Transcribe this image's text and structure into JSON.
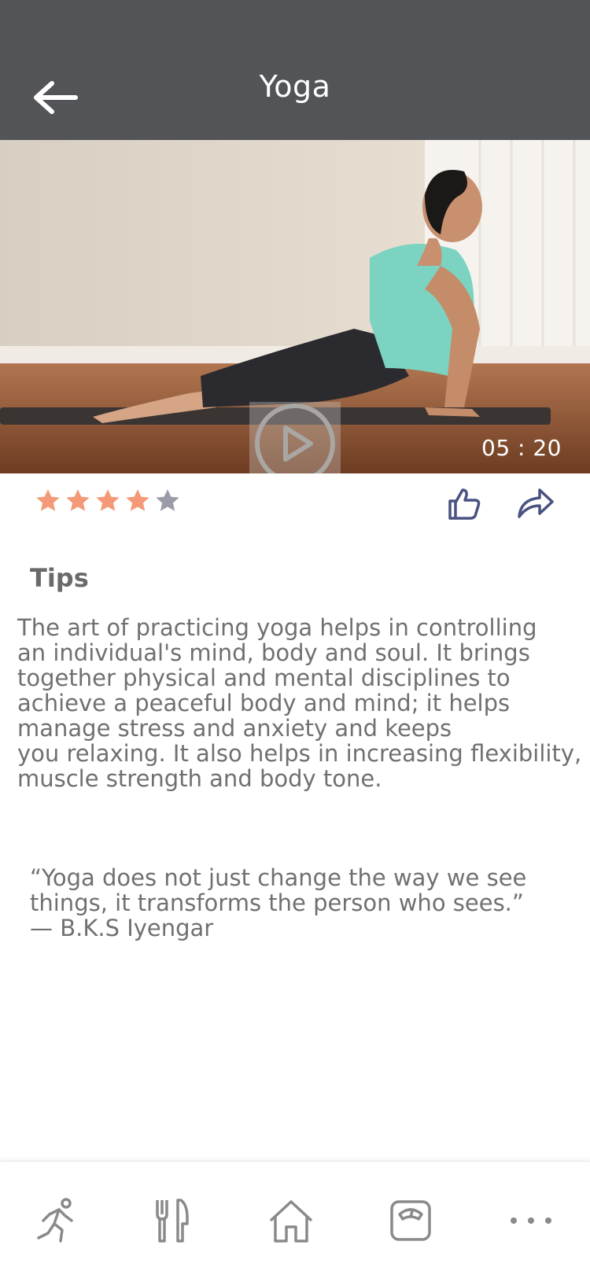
{
  "header": {
    "title": "Yoga",
    "back_icon": "arrow-left-icon"
  },
  "video": {
    "duration": "05 : 20",
    "play_icon": "play-circle-icon"
  },
  "rating": {
    "value": 4,
    "max": 5,
    "filled_color": "#F59A78",
    "empty_color": "#9C9CA8"
  },
  "actions": {
    "like_icon": "thumbs-up-icon",
    "share_icon": "share-arrow-icon",
    "icon_color": "#4A5280"
  },
  "tips": {
    "heading": "Tips",
    "body": "The art of practicing yoga helps in controlling\n an individual's mind, body and soul. It brings\ntogether physical and mental disciplines to\nachieve a peaceful body and mind; it helps\nmanage stress and anxiety and keeps\nyou relaxing. It also helps in increasing flexibility,\nmuscle strength and body tone."
  },
  "quote": {
    "text": "“Yoga does not just change the way we see\n  things, it transforms the person who sees.”\n     — B.K.S Iyengar"
  },
  "tabbar": {
    "items": [
      {
        "icon": "running-icon"
      },
      {
        "icon": "fork-knife-icon"
      },
      {
        "icon": "home-icon"
      },
      {
        "icon": "scale-icon"
      },
      {
        "icon": "more-dots-icon"
      }
    ],
    "icon_color": "#8A8A8A"
  }
}
